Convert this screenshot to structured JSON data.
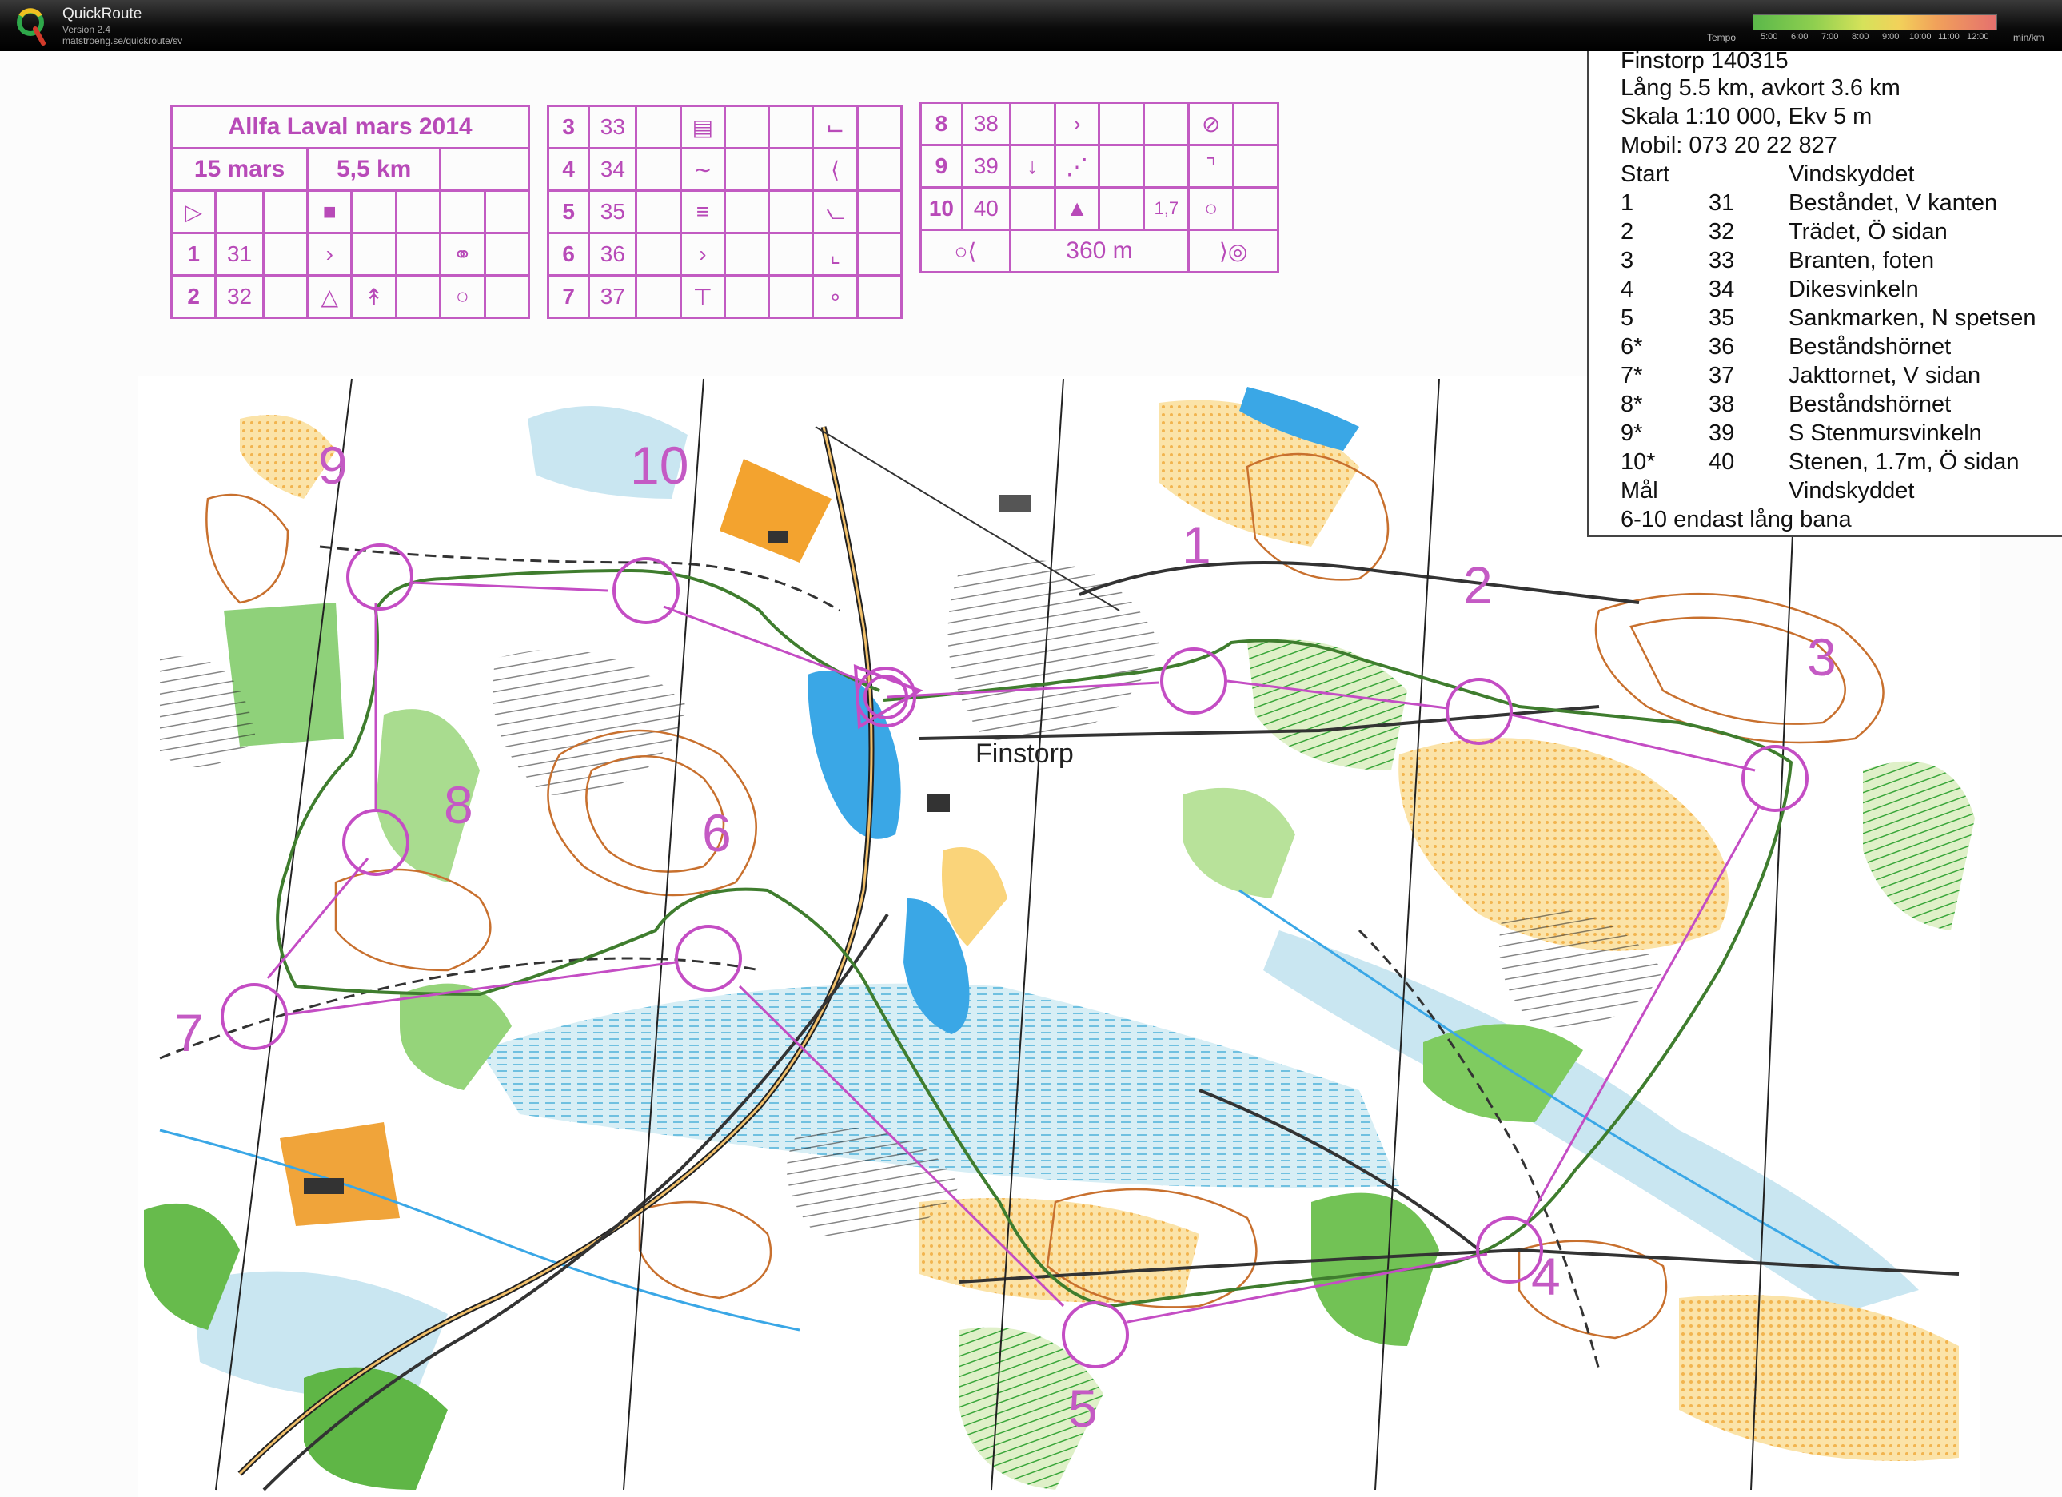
{
  "app": {
    "name": "QuickRoute",
    "version": "Version 2.4",
    "url": "matstroeng.se/quickroute/sv",
    "tempo_label": "Tempo",
    "unit": "min/km",
    "tempo_ticks": [
      "5:00",
      "6:00",
      "7:00",
      "8:00",
      "9:00",
      "10:00",
      "11:00",
      "12:00"
    ]
  },
  "colors": {
    "course": "#c44dc4",
    "route": "#3f7d2e",
    "forest_green": "#49b64a",
    "open_yellow": "#f4c56a",
    "marsh_blue": "#bfe3ee",
    "water": "#3aa7e6"
  },
  "description_table_1": {
    "title": "Allfa Laval mars 2014",
    "date": "15 mars",
    "length": "5,5 km",
    "rows": [
      {
        "num": "1",
        "code": "31"
      },
      {
        "num": "2",
        "code": "32"
      }
    ]
  },
  "description_table_2": {
    "rows": [
      {
        "num": "3",
        "code": "33"
      },
      {
        "num": "4",
        "code": "34"
      },
      {
        "num": "5",
        "code": "35"
      },
      {
        "num": "6",
        "code": "36"
      },
      {
        "num": "7",
        "code": "37"
      }
    ]
  },
  "description_table_3": {
    "rows": [
      {
        "num": "8",
        "code": "38",
        "extra": ""
      },
      {
        "num": "9",
        "code": "39",
        "extra": ""
      },
      {
        "num": "10",
        "code": "40",
        "extra": "1,7"
      }
    ],
    "finish_distance": "360 m"
  },
  "course_info": {
    "event": "Finstorp 140315",
    "long": "Lång 5.5 km,  avkort 3.6 km",
    "scale": "Skala 1:10 000, Ekv 5 m",
    "phone": "Mobil: 073 20 22 827",
    "legs": [
      {
        "no": "Start",
        "code": "",
        "desc": "Vindskyddet"
      },
      {
        "no": "1",
        "code": "31",
        "desc": "Beståndet, V kanten"
      },
      {
        "no": "2",
        "code": "32",
        "desc": "Trädet, Ö sidan"
      },
      {
        "no": "3",
        "code": "33",
        "desc": "Branten, foten"
      },
      {
        "no": "4",
        "code": "34",
        "desc": "Dikesvinkeln"
      },
      {
        "no": "5",
        "code": "35",
        "desc": "Sankmarken, N spetsen"
      },
      {
        "no": "6*",
        "code": "36",
        "desc": "Beståndshörnet"
      },
      {
        "no": "7*",
        "code": "37",
        "desc": "Jakttornet, V sidan"
      },
      {
        "no": "8*",
        "code": "38",
        "desc": "Beståndshörnet"
      },
      {
        "no": "9*",
        "code": "39",
        "desc": "S Stenmursvinkeln"
      },
      {
        "no": "10*",
        "code": "40",
        "desc": "Stenen, 1.7m, Ö sidan"
      },
      {
        "no": "Mål",
        "code": "",
        "desc": "Vindskyddet"
      }
    ],
    "note": "6-10 endast lång bana"
  },
  "map": {
    "place_name": "Finstorp",
    "control_numbers": [
      "1",
      "2",
      "3",
      "4",
      "5",
      "6",
      "7",
      "8",
      "9",
      "10"
    ]
  }
}
